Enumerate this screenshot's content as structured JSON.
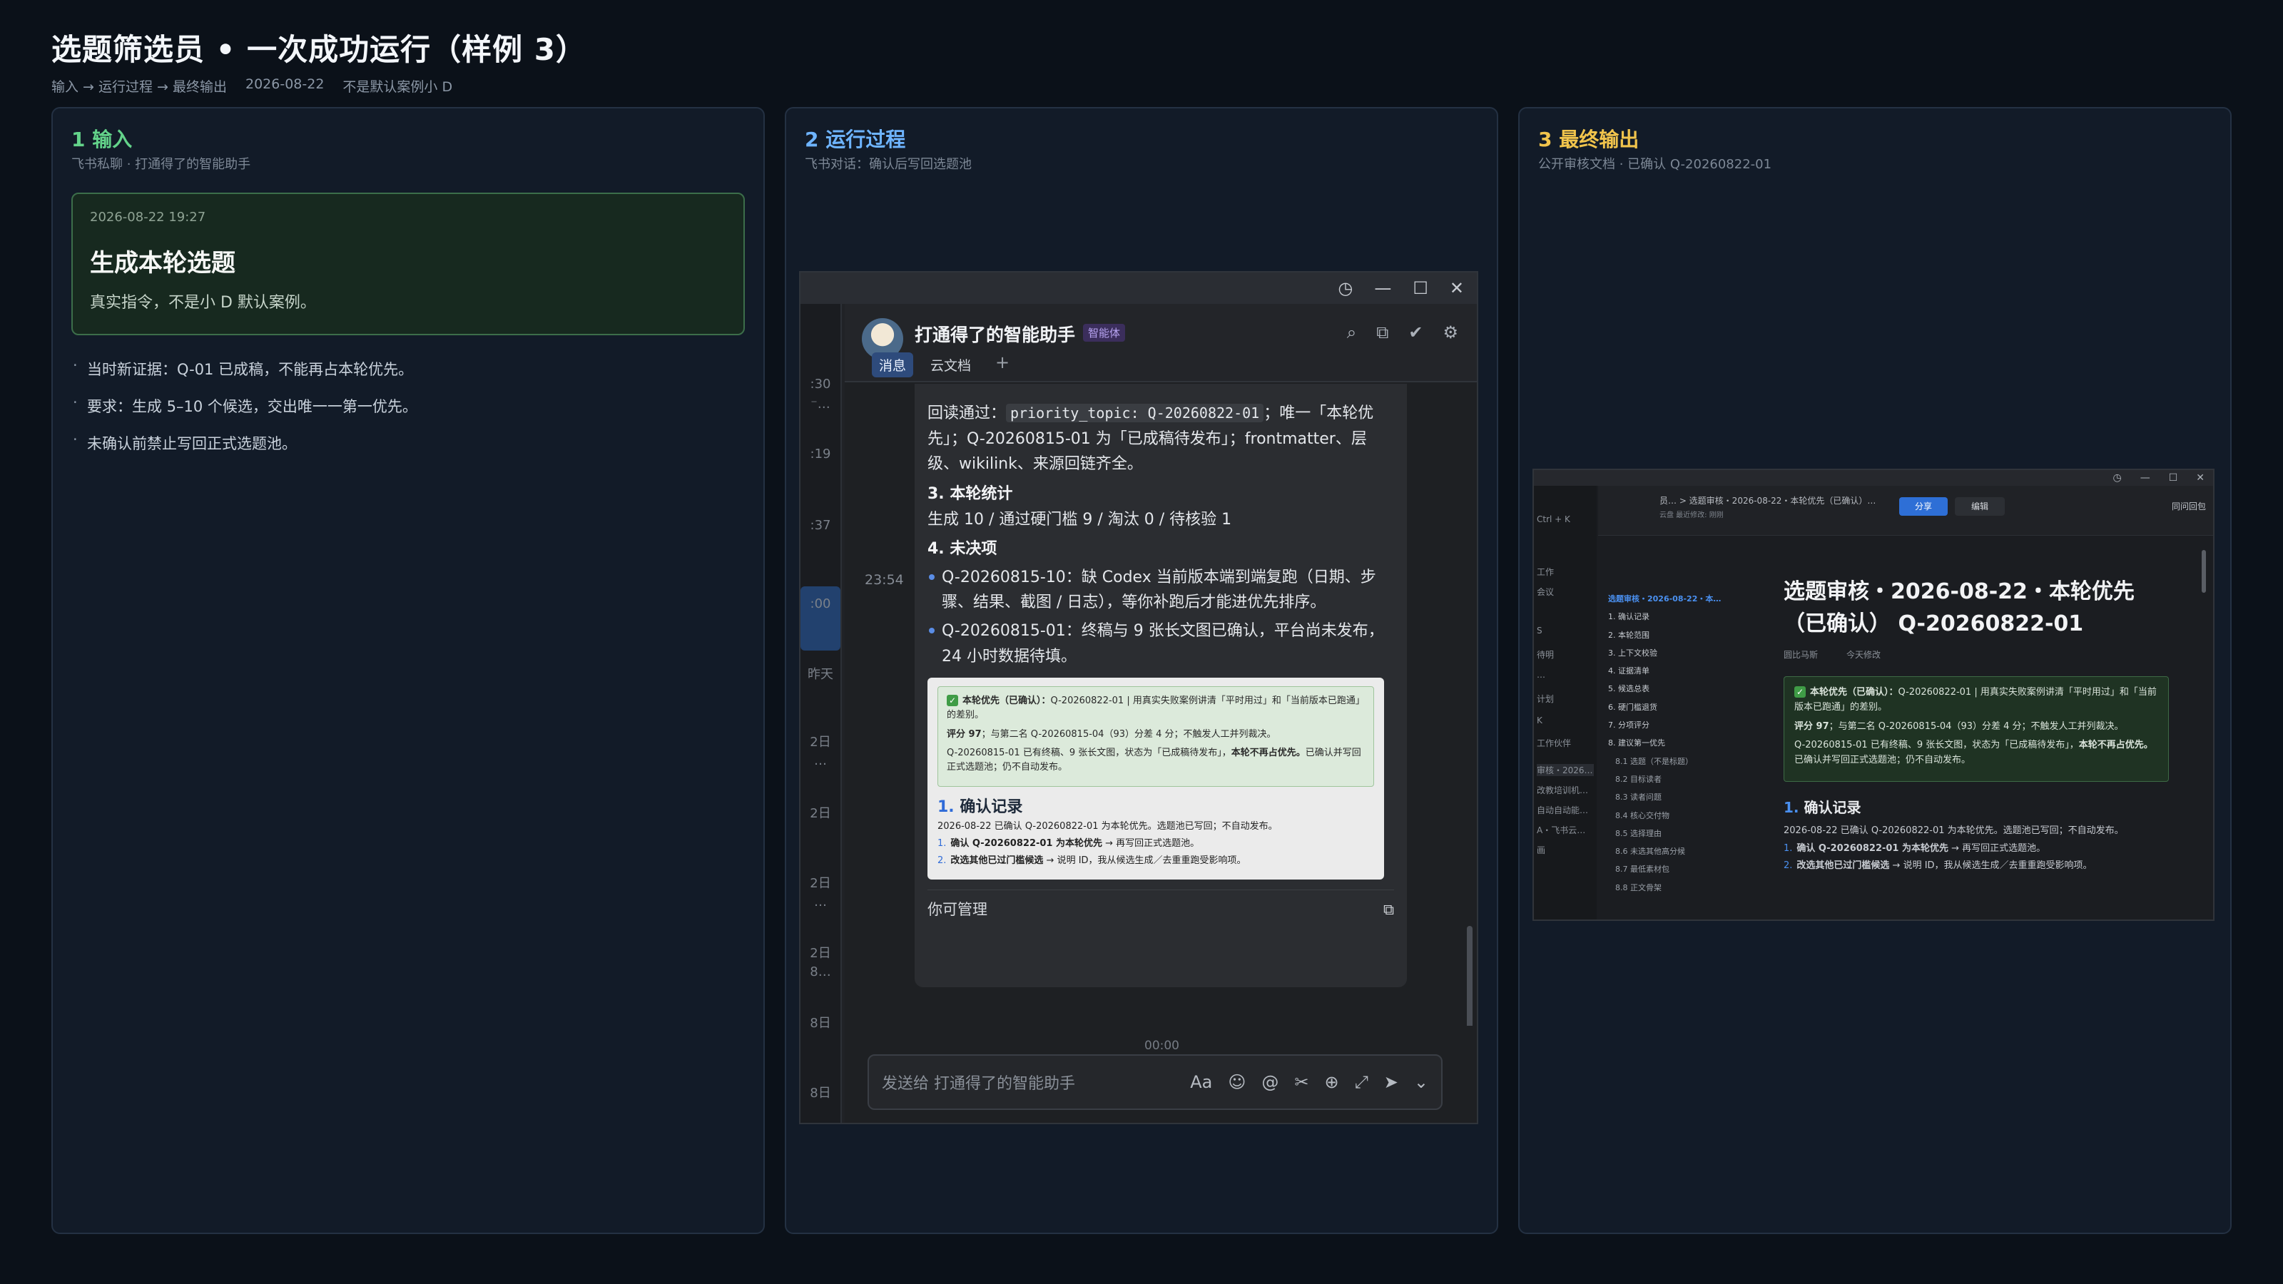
{
  "header": {
    "title": "选题筛选员 • 一次成功运行（样例 3）",
    "flow": "输入 → 运行过程 → 最终输出",
    "date": "2026-08-22",
    "note": "不是默认案例小 D"
  },
  "panel_input": {
    "title": "1  输入",
    "caption": "飞书私聊 · 打通得了的智能助手",
    "card": {
      "timestamp": "2026-08-22  19:27",
      "command": "生成本轮选题",
      "desc": "真实指令，不是小 D 默认案例。"
    },
    "bullets": [
      "当时新证据：Q-01 已成稿，不能再占本轮优先。",
      "要求：生成 5–10 个候选，交出唯一一第一优先。",
      "未确认前禁止写回正式选题池。"
    ]
  },
  "panel_process": {
    "title": "2  运行过程",
    "caption": "飞书对话：确认后写回选题池",
    "window_icons": [
      "history-icon",
      "minimize-icon",
      "maximize-icon",
      "close-icon"
    ],
    "left_strip": [
      ":30",
      "⁻…",
      ":19",
      ":37",
      ":00",
      "昨天",
      "2日",
      "…",
      "2日",
      "2日",
      "…",
      "2日",
      "8…",
      "8日",
      "8日"
    ],
    "chat": {
      "bot_name": "打通得了的智能助手",
      "bot_tag": "智能体",
      "tabs": [
        "消息",
        "云文档",
        "+"
      ],
      "time": "23:54",
      "msg_prefix": "回读通过：",
      "msg_code": "priority_topic: Q-20260822-01",
      "msg_rest": "；唯一「本轮优先」；Q-20260815-01 为「已成稿待发布」；frontmatter、层级、wikilink、来源回链齐全。",
      "stats_heading": "3. 本轮统计",
      "stats": "生成 10 / 通过硬门槛 9 / 淘汰 0 / 待核验 1",
      "pending_heading": "4. 未决项",
      "pending": [
        "Q-20260815-10：缺 Codex 当前版本端到端复跑（日期、步骤、结果、截图 / 日志），等你补跑后才能进优先排序。",
        "Q-20260815-01：终稿与 9 张长文图已确认，平台尚未发布，24 小时数据待填。"
      ],
      "preview": {
        "g1_label": "本轮优先（已确认）：",
        "g1_text": "Q-20260822-01 | 用真实失败案例讲清「平时用过」和「当前版本已跑通」的差别。",
        "g2_label": "评分 97",
        "g2_text": "；与第二名 Q-20260815-04（93）分差 4 分；不触发人工并列裁决。",
        "g3_text": "Q-20260815-01 已有终稿、9 张长文图，状态为「已成稿待发布」，",
        "g3_bold": "本轮不再占优先。",
        "g3_tail": "已确认并写回正式选题池；仍不自动发布。",
        "h_num": "1.",
        "h_text": "确认记录",
        "line": "2026-08-22 已确认 Q-20260822-01 为本轮优先。选题池已写回；不自动发布。",
        "items": [
          {
            "n": "1.",
            "b": "确认 Q-20260822-01 为本轮优先",
            "t": " → 再写回正式选题池。"
          },
          {
            "n": "2.",
            "b": "改选其他已过门槛候选",
            "t": " → 说明 ID，我从候选生成／去重重跑受影响项。"
          }
        ]
      },
      "manage": "你可管理",
      "time2": "00:00",
      "input_placeholder": "发送给 打通得了的智能助手"
    }
  },
  "panel_output": {
    "title": "3  最终输出",
    "caption": "公开审核文档 · 已确认 Q-20260822-01",
    "doc": {
      "crumb": "员…   >  选题审核・2026-08-22・本轮优先（已确认）…",
      "crumb2": "云盘    最近修改: 刚刚",
      "share": "分享",
      "edit": "编辑",
      "right_tool": "同问回包",
      "left_items": [
        "Ctrl + K",
        "工作",
        "会议",
        "S",
        "待明",
        "…",
        "计划",
        "K",
        "工作伙伴",
        "审核・2026…",
        "改教培训机…",
        "自动自动能…",
        "A・飞书云…",
        "画"
      ],
      "toc": [
        {
          "t": "选题审核・2026-08-22・本…",
          "c": "act"
        },
        {
          "t": "1. 确认记录",
          "c": ""
        },
        {
          "t": "2. 本轮范围",
          "c": ""
        },
        {
          "t": "3. 上下文校验",
          "c": ""
        },
        {
          "t": "4. 证据清单",
          "c": ""
        },
        {
          "t": "5. 候选总表",
          "c": ""
        },
        {
          "t": "6. 硬门槛退货",
          "c": ""
        },
        {
          "t": "7. 分项评分",
          "c": ""
        },
        {
          "t": "8. 建议第一优先",
          "c": ""
        },
        {
          "t": "8.1 选题（不是标题）",
          "c": "ind"
        },
        {
          "t": "8.2 目标读者",
          "c": "ind"
        },
        {
          "t": "8.3 读者问题",
          "c": "ind"
        },
        {
          "t": "8.4 核心交付物",
          "c": "ind"
        },
        {
          "t": "8.5 选择理由",
          "c": "ind"
        },
        {
          "t": "8.6 未选其他高分候",
          "c": "ind"
        },
        {
          "t": "8.7 最低素材包",
          "c": "ind"
        },
        {
          "t": "8.8 正文骨架",
          "c": "ind"
        }
      ],
      "title": "选题审核・2026-08-22・本轮优先（已确认） Q-20260822-01",
      "meta_author": "圆比马斯",
      "meta_time": "今天修改",
      "g1_label": "本轮优先（已确认）：",
      "g1_text": "Q-20260822-01 | 用真实失败案例讲清「平时用过」和「当前版本已跑通」的差别。",
      "g2_label": "评分 97",
      "g2_text": "；与第二名 Q-20260815-04（93）分差 4 分；不触发人工并列裁决。",
      "g3_text": "Q-20260815-01 已有终稿、9 张长文图，状态为「已成稿待发布」，",
      "g3_bold": "本轮不再占优先。",
      "g3_tail": "已确认并写回正式选题池；仍不自动发布。",
      "h_num": "1.",
      "h_text": "确认记录",
      "line": "2026-08-22 已确认 Q-20260822-01 为本轮优先。选题池已写回；不自动发布。",
      "items": [
        {
          "n": "1.",
          "b": "确认 Q-20260822-01 为本轮优先",
          "t": " → 再写回正式选题池。"
        },
        {
          "n": "2.",
          "b": "改选其他已过门槛候选",
          "t": " → 说明 ID，我从候选生成／去重重跑受影响项。"
        }
      ]
    }
  },
  "colors": {
    "input_accent": "#63d38a",
    "process_accent": "#6eb4ff",
    "output_accent": "#f1c44c"
  }
}
